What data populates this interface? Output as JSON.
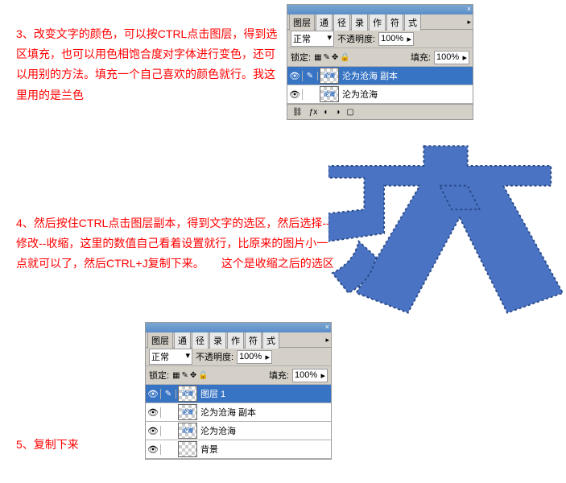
{
  "step3_text": "3、改变文字的颜色，可以按CTRL点击图层，得到选区填充，也可以用色相饱合度对字体进行变色，还可以用别的方法。填充一个自己喜欢的颜色就行。我这里用的是兰色",
  "step4_text": "4、然后按住CTRL点击图层副本，得到文字的选区，然后选择--修改--收缩，这里的数值自己看着设置就行，比原来的图片小一点就可以了，然后CTRL+J复制下来。　　这个是收缩之后的选区",
  "step5_text": "5、复制下来",
  "panel": {
    "tabs": [
      "图层",
      "通",
      "径",
      "录",
      "作",
      "符",
      "式"
    ],
    "mode_label": "正常",
    "opacity_label": "不透明度:",
    "opacity_value": "100%",
    "lock_label": "锁定:",
    "fill_label": "填充:",
    "fill_value": "100%"
  },
  "panel1_layers": [
    {
      "name": "沦为沧海 副本",
      "selected": true,
      "thumb": "沦海"
    },
    {
      "name": "沦为沧海",
      "selected": false,
      "thumb": "沦海"
    }
  ],
  "panel2_layers": [
    {
      "name": "图层 1",
      "selected": true,
      "thumb": "沦海"
    },
    {
      "name": "沦为沧海 副本",
      "selected": false,
      "thumb": "沦海"
    },
    {
      "name": "沦为沧海",
      "selected": false,
      "thumb": "沦海"
    },
    {
      "name": "背景",
      "selected": false,
      "thumb": ""
    }
  ]
}
